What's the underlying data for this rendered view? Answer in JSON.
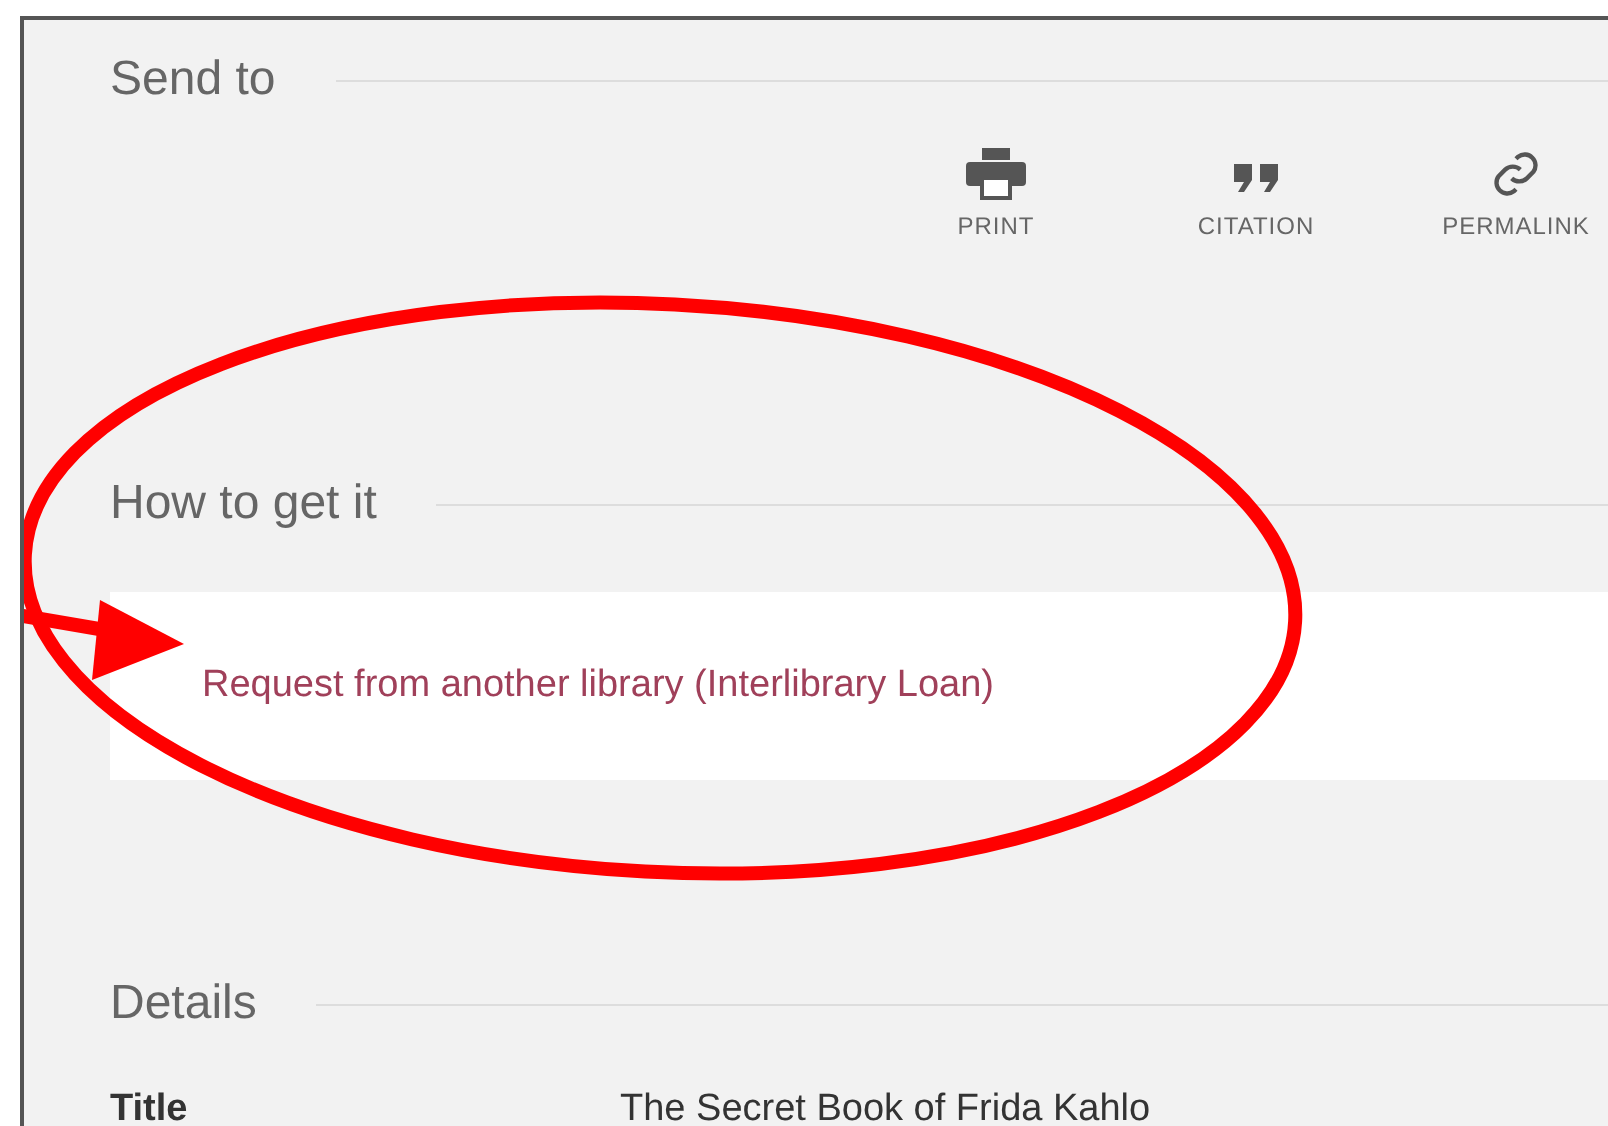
{
  "send_to": {
    "heading": "Send to",
    "actions": [
      {
        "kind": "print",
        "label": "PRINT"
      },
      {
        "kind": "citation",
        "label": "CITATION"
      },
      {
        "kind": "permalink",
        "label": "PERMALINK"
      }
    ]
  },
  "how_to_get_it": {
    "heading": "How to get it",
    "link": "Request from another library (Interlibrary Loan)"
  },
  "details": {
    "heading": "Details",
    "rows": [
      {
        "label": "Title",
        "value": "The Secret Book of Frida Kahlo"
      }
    ]
  },
  "annotation": {
    "kind": "ellipse-with-arrow",
    "color": "#ff0000"
  }
}
